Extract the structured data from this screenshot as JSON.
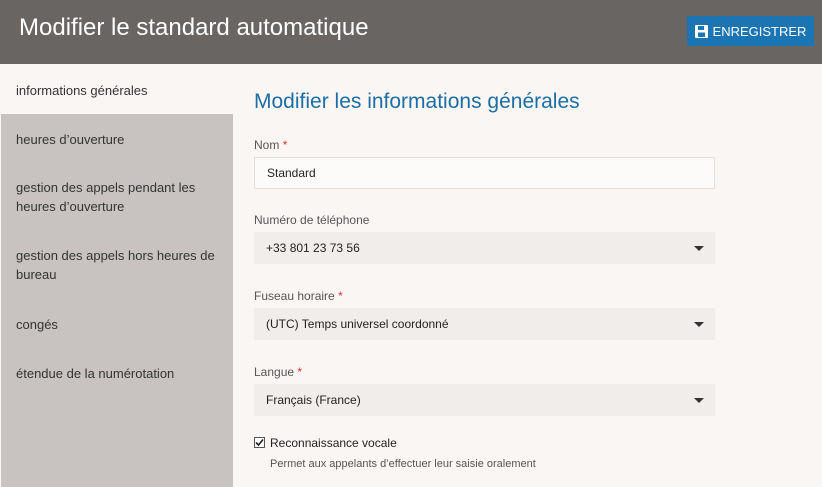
{
  "header": {
    "title": "Modifier le standard automatique",
    "save_label": "ENREGISTRER"
  },
  "sidebar": {
    "items": [
      {
        "label": "informations générales",
        "active": true
      },
      {
        "label": "heures d’ouverture",
        "active": false
      },
      {
        "label": "gestion des appels pendant les heures d’ouverture",
        "active": false
      },
      {
        "label": "gestion des appels hors heures de bureau",
        "active": false
      },
      {
        "label": "congés",
        "active": false
      },
      {
        "label": "étendue de la numérotation",
        "active": false
      }
    ]
  },
  "main": {
    "title": "Modifier les informations générales",
    "name": {
      "label": "Nom",
      "required": "*",
      "value": "Standard"
    },
    "phone": {
      "label": "Numéro de téléphone",
      "value": "+33 801 23 73 56"
    },
    "timezone": {
      "label": "Fuseau horaire",
      "required": "*",
      "value": "(UTC) Temps universel coordonné"
    },
    "language": {
      "label": "Langue",
      "required": "*",
      "value": "Français (France)"
    },
    "voice": {
      "checked": true,
      "label": "Reconnaissance vocale",
      "description": "Permet aux appelants d’effectuer leur saisie oralement"
    }
  },
  "colors": {
    "header": "#686563",
    "accent": "#1c75b3",
    "title": "#1c6ea4",
    "sidebar": "#c8c3c0",
    "required": "#d9352a"
  },
  "icons": {
    "save": "floppy-disk-icon",
    "dropdown": "chevron-down-icon",
    "checkbox": "checkmark-icon"
  }
}
